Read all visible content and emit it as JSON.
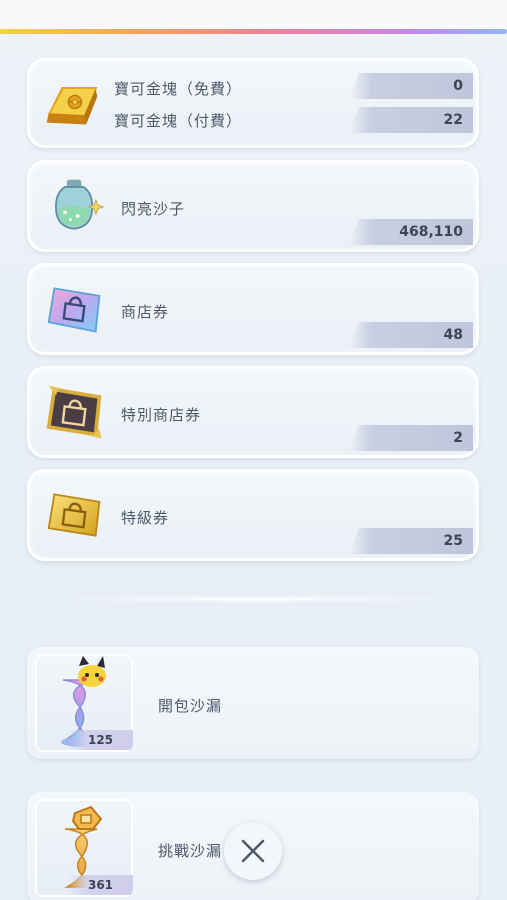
{
  "currencies": [
    {
      "name": "pokegold",
      "rows": [
        {
          "label": "寶可金塊（免費）",
          "value": "0"
        },
        {
          "label": "寶可金塊（付費）",
          "value": "22"
        }
      ]
    },
    {
      "name": "shinedust",
      "label": "閃亮沙子",
      "value": "468,110"
    },
    {
      "name": "shop-ticket",
      "label": "商店券",
      "value": "48"
    },
    {
      "name": "special-shop-ticket",
      "label": "特別商店券",
      "value": "2"
    },
    {
      "name": "premium-ticket",
      "label": "特級券",
      "value": "25"
    }
  ],
  "hourglasses": [
    {
      "label": "開包沙漏",
      "count": "125"
    },
    {
      "label": "挑戰沙漏",
      "count": "361"
    }
  ],
  "icons": {
    "pokegold": "gold-bar-icon",
    "shinedust": "shinedust-bottle-icon",
    "shop_ticket": "shopping-bag-ticket-icon",
    "special_shop_ticket": "special-shopping-bag-ticket-icon",
    "premium_ticket": "gold-shopping-bag-ticket-icon",
    "close": "close-icon"
  },
  "colors": {
    "accent_rainbow": [
      "#f1d24b",
      "#f3a655",
      "#ee7f9a",
      "#c786e6",
      "#8fb6f2"
    ],
    "value_bar": "#c4cadf"
  }
}
